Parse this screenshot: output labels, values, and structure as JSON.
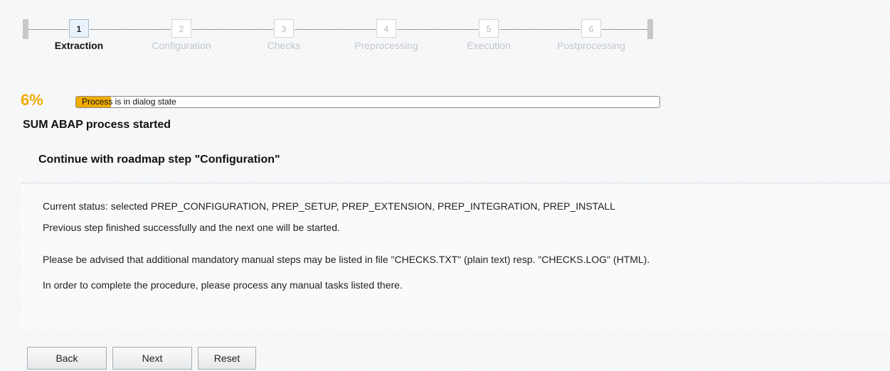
{
  "roadmap": {
    "steps": [
      {
        "number": "1",
        "label": "Extraction",
        "state": "active"
      },
      {
        "number": "2",
        "label": "Configuration",
        "state": "inactive"
      },
      {
        "number": "3",
        "label": "Checks",
        "state": "inactive"
      },
      {
        "number": "4",
        "label": "Preprocessing",
        "state": "inactive"
      },
      {
        "number": "5",
        "label": "Execution",
        "state": "inactive"
      },
      {
        "number": "6",
        "label": "Postprocessing",
        "state": "inactive"
      }
    ]
  },
  "progress": {
    "percent_text": "6%",
    "value_percent": 6,
    "status_text": "Process is in dialog state",
    "fill_color": "#f0ab00"
  },
  "process_title": "SUM ABAP process started",
  "dialog_title": "Continue with roadmap step \"Configuration\"",
  "messages": {
    "status": "Current status: selected PREP_CONFIGURATION, PREP_SETUP, PREP_EXTENSION, PREP_INTEGRATION, PREP_INSTALL",
    "finished": "Previous step finished successfully and the next one will be started.",
    "advice": "Please be advised that additional mandatory manual steps may be listed in file \"CHECKS.TXT\" (plain text) resp. \"CHECKS.LOG\" (HTML).",
    "manual_tasks": "In order to complete the procedure, please process any manual tasks listed there."
  },
  "buttons": {
    "back": "Back",
    "next": "Next",
    "reset": "Reset"
  }
}
